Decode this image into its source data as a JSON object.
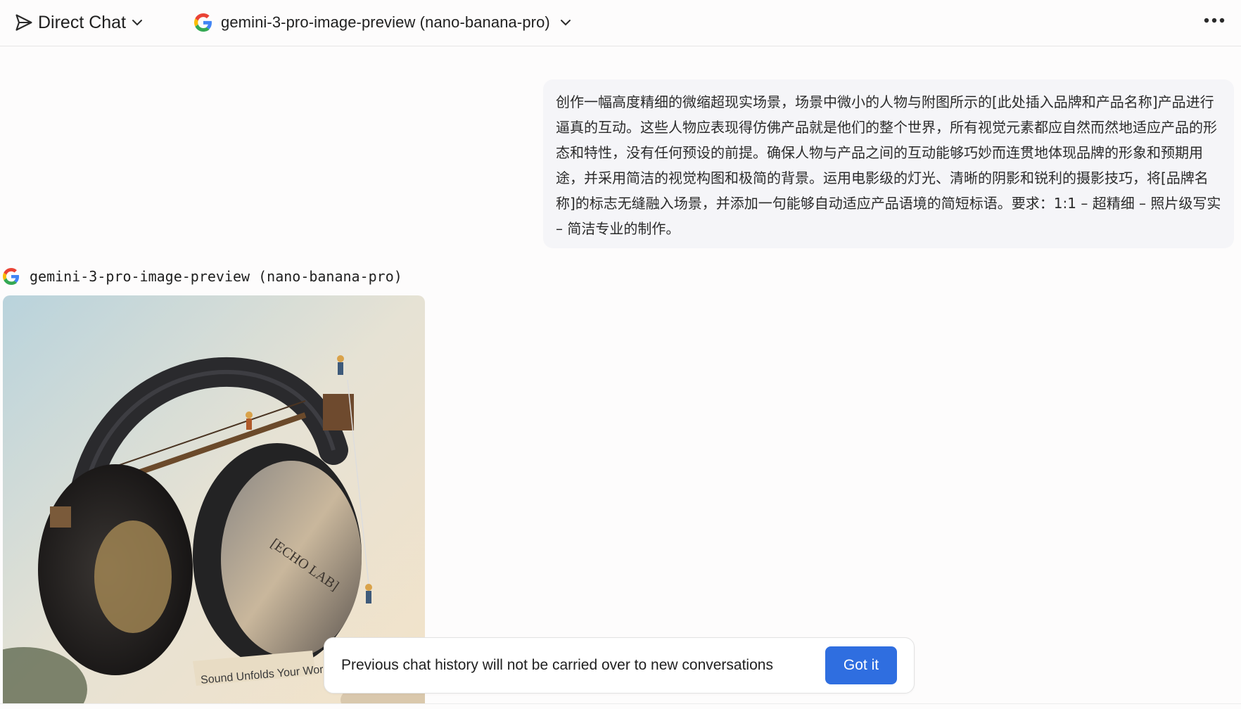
{
  "header": {
    "mode_label": "Direct Chat",
    "model_label": "gemini-3-pro-image-preview (nano-banana-pro)"
  },
  "user_message": {
    "text": "创作一幅高度精细的微缩超现实场景，场景中微小的人物与附图所示的[此处插入品牌和产品名称]产品进行逼真的互动。这些人物应表现得仿佛产品就是他们的整个世界，所有视觉元素都应自然而然地适应产品的形态和特性，没有任何预设的前提。确保人物与产品之间的互动能够巧妙而连贯地体现品牌的形象和预期用途，并采用简洁的视觉构图和极简的背景。运用电影级的灯光、清晰的阴影和锐利的摄影技巧，将[品牌名称]的标志无缝融入场景，并添加一句能够自动适应产品语境的简短标语。要求：1:1 – 超精细 – 照片级写实 – 简洁专业的制作。"
  },
  "assistant": {
    "model_name": "gemini-3-pro-image-preview (nano-banana-pro)",
    "image": {
      "brand_text": "[ECHO LAB]",
      "banner_text": "Sound Unfolds Your World."
    }
  },
  "toast": {
    "message": "Previous chat history will not be carried over to new conversations",
    "button_label": "Got it"
  },
  "colors": {
    "accent": "#2f6ee0",
    "bubble_bg": "#f5f5f8",
    "page_bg": "#fdfcfc"
  }
}
